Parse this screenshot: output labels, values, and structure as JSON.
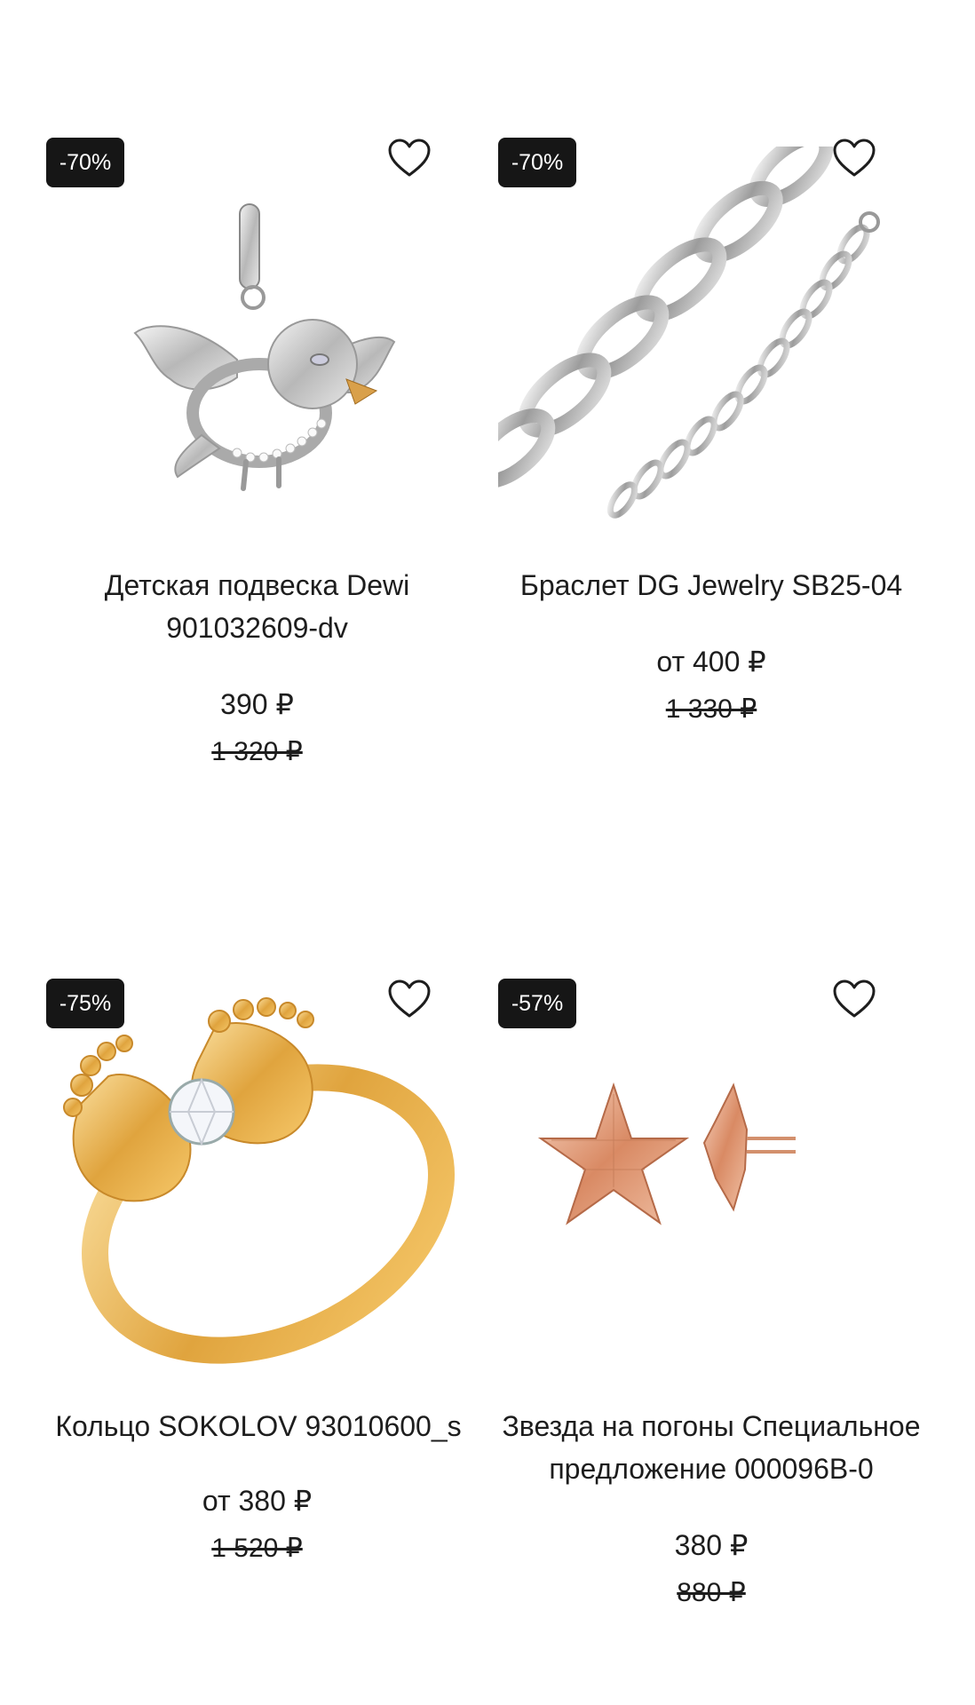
{
  "products": [
    {
      "badge": "-70%",
      "title": "Детская подвеска Dewi\n901032609-dv",
      "price": "390 ₽",
      "old_price": "1 320 ₽",
      "image_icon": "bird-pendant-image",
      "favorite_icon": "heart-outline-icon"
    },
    {
      "badge": "-70%",
      "title": "Браслет DG Jewelry SB25-04",
      "price": "от 400 ₽",
      "old_price": "1 330 ₽",
      "image_icon": "chain-bracelet-image",
      "favorite_icon": "heart-outline-icon"
    },
    {
      "badge": "-75%",
      "title": "Кольцо SOKOLOV 93010600_s",
      "price": "от 380 ₽",
      "old_price": "1 520 ₽",
      "image_icon": "gold-ring-feet-image",
      "favorite_icon": "heart-outline-icon"
    },
    {
      "badge": "-57%",
      "title": "Звезда на погоны Специальное\nпредложение 000096B-0",
      "price": "380 ₽",
      "old_price": "880 ₽",
      "image_icon": "star-epaulet-image",
      "favorite_icon": "heart-outline-icon"
    }
  ],
  "colors": {
    "badge_bg": "#161616",
    "text": "#1d1d1d",
    "background": "#ffffff"
  }
}
